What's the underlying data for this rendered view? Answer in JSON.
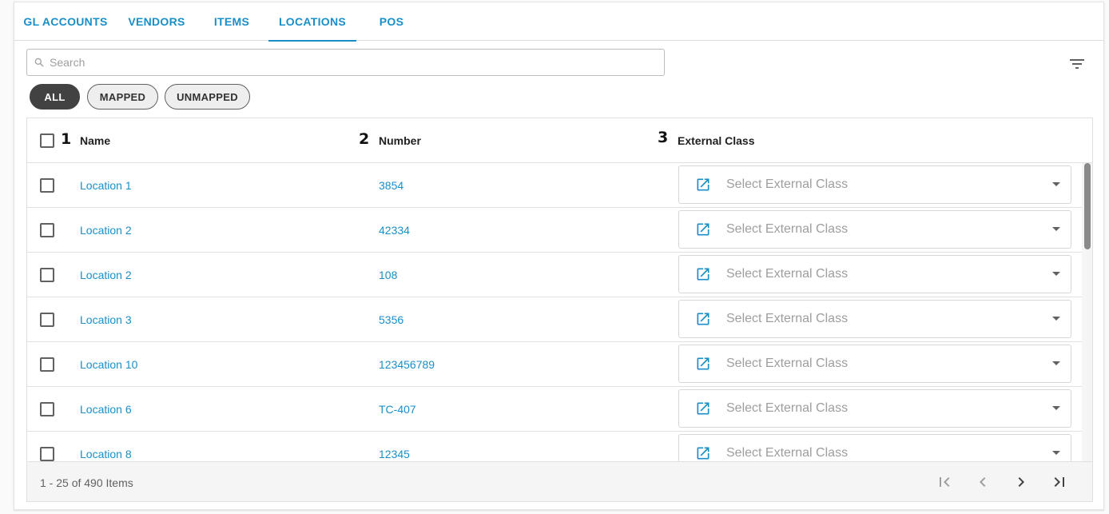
{
  "tabs": [
    {
      "label": "GL ACCOUNTS",
      "active": false
    },
    {
      "label": "VENDORS",
      "active": false
    },
    {
      "label": "ITEMS",
      "active": false
    },
    {
      "label": "LOCATIONS",
      "active": true
    },
    {
      "label": "POS",
      "active": false
    }
  ],
  "search": {
    "placeholder": "Search"
  },
  "filters": [
    {
      "label": "ALL",
      "active": true
    },
    {
      "label": "MAPPED",
      "active": false
    },
    {
      "label": "UNMAPPED",
      "active": false
    }
  ],
  "columns": [
    {
      "marker": "1",
      "label": "Name"
    },
    {
      "marker": "2",
      "label": "Number"
    },
    {
      "marker": "3",
      "label": "External Class"
    }
  ],
  "rows": [
    {
      "name": "Location 1",
      "number": "3854",
      "external_class": "Select External Class"
    },
    {
      "name": "Location 2",
      "number": "42334",
      "external_class": "Select External Class"
    },
    {
      "name": "Location 2",
      "number": "108",
      "external_class": "Select External Class"
    },
    {
      "name": "Location 3",
      "number": "5356",
      "external_class": "Select External Class"
    },
    {
      "name": "Location 10",
      "number": "123456789",
      "external_class": "Select External Class"
    },
    {
      "name": "Location 6",
      "number": "TC-407",
      "external_class": "Select External Class"
    },
    {
      "name": "Location 8",
      "number": "12345",
      "external_class": "Select External Class"
    }
  ],
  "pager": {
    "summary": "1 - 25 of 490 Items"
  },
  "colors": {
    "accent": "#1a8fc7",
    "chip_active": "#424242"
  }
}
